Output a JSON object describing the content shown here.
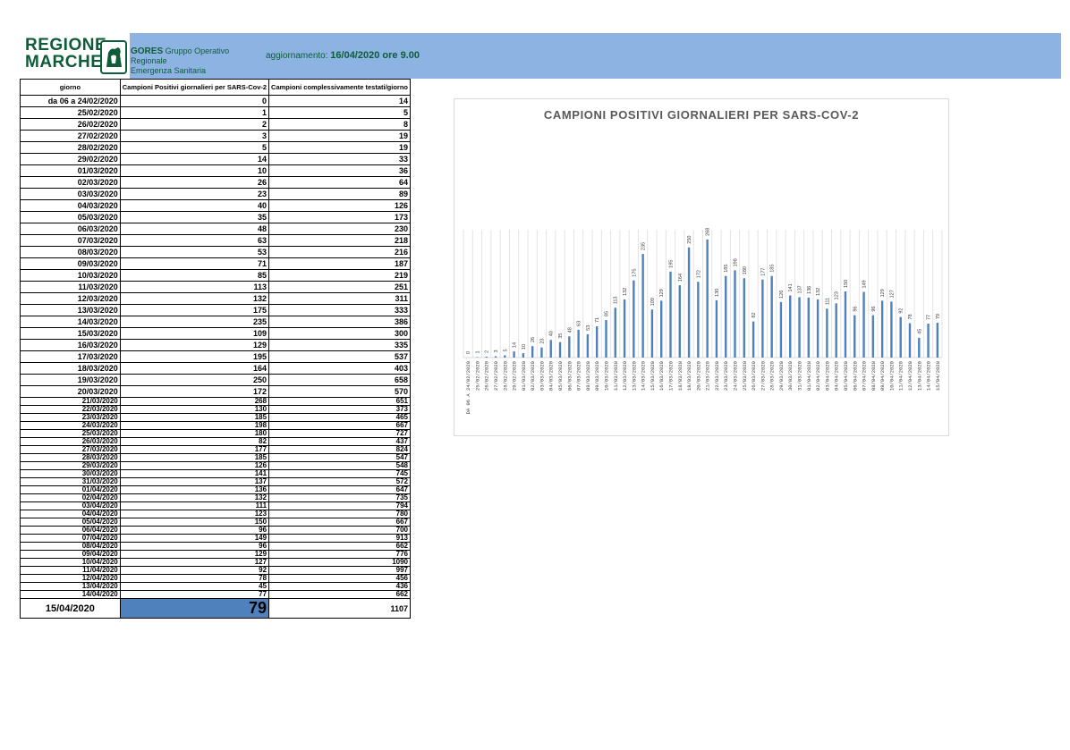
{
  "header": {
    "logo_line1": "REGIONE",
    "logo_line2": "MARCHE",
    "gores_name": "GORES",
    "gores_desc1": "Gruppo Operativo Regionale",
    "gores_desc2": "Emergenza Sanitaria",
    "update_prefix": "aggiornamento:",
    "update_value": "16/04/2020 ore 9.00"
  },
  "colors": {
    "header_band": "#8db3e2",
    "bar": "#4f81bd",
    "logo_green": "#0e5c38"
  },
  "table": {
    "headers": [
      "giorno",
      "Campioni Positivi giornalieri per SARS-Cov-2",
      "Campioni complessivamente testati/giorno"
    ],
    "rows": [
      [
        "da 06 a 24/02/2020",
        "0",
        "14"
      ],
      [
        "25/02/2020",
        "1",
        "5"
      ],
      [
        "26/02/2020",
        "2",
        "8"
      ],
      [
        "27/02/2020",
        "3",
        "19"
      ],
      [
        "28/02/2020",
        "5",
        "19"
      ],
      [
        "29/02/2020",
        "14",
        "33"
      ],
      [
        "01/03/2020",
        "10",
        "36"
      ],
      [
        "02/03/2020",
        "26",
        "64"
      ],
      [
        "03/03/2020",
        "23",
        "89"
      ],
      [
        "04/03/2020",
        "40",
        "126"
      ],
      [
        "05/03/2020",
        "35",
        "173"
      ],
      [
        "06/03/2020",
        "48",
        "230"
      ],
      [
        "07/03/2020",
        "63",
        "218"
      ],
      [
        "08/03/2020",
        "53",
        "216"
      ],
      [
        "09/03/2020",
        "71",
        "187"
      ],
      [
        "10/03/2020",
        "85",
        "219"
      ],
      [
        "11/03/2020",
        "113",
        "251"
      ],
      [
        "12/03/2020",
        "132",
        "311"
      ],
      [
        "13/03/2020",
        "175",
        "333"
      ],
      [
        "14/03/2020",
        "235",
        "386"
      ],
      [
        "15/03/2020",
        "109",
        "300"
      ],
      [
        "16/03/2020",
        "129",
        "335"
      ],
      [
        "17/03/2020",
        "195",
        "537"
      ],
      [
        "18/03/2020",
        "164",
        "403"
      ],
      [
        "19/03/2020",
        "250",
        "658"
      ],
      [
        "20/03/2020",
        "172",
        "570"
      ],
      [
        "21/03/2020",
        "268",
        "651"
      ],
      [
        "22/03/2020",
        "130",
        "373"
      ],
      [
        "23/03/2020",
        "185",
        "465"
      ],
      [
        "24/03/2020",
        "198",
        "667"
      ],
      [
        "25/03/2020",
        "180",
        "727"
      ],
      [
        "26/03/2020",
        "82",
        "437"
      ],
      [
        "27/03/2020",
        "177",
        "824"
      ],
      [
        "28/03/2020",
        "185",
        "547"
      ],
      [
        "29/03/2020",
        "126",
        "548"
      ],
      [
        "30/03/2020",
        "141",
        "745"
      ],
      [
        "31/03/2020",
        "137",
        "572"
      ],
      [
        "01/04/2020",
        "136",
        "647"
      ],
      [
        "02/04/2020",
        "132",
        "735"
      ],
      [
        "03/04/2020",
        "111",
        "794"
      ],
      [
        "04/04/2020",
        "123",
        "780"
      ],
      [
        "05/04/2020",
        "150",
        "667"
      ],
      [
        "06/04/2020",
        "96",
        "700"
      ],
      [
        "07/04/2020",
        "149",
        "913"
      ],
      [
        "08/04/2020",
        "96",
        "662"
      ],
      [
        "09/04/2020",
        "129",
        "776"
      ],
      [
        "10/04/2020",
        "127",
        "1090"
      ],
      [
        "11/04/2020",
        "92",
        "997"
      ],
      [
        "12/04/2020",
        "78",
        "456"
      ],
      [
        "13/04/2020",
        "45",
        "436"
      ],
      [
        "14/04/2020",
        "77",
        "662"
      ],
      [
        "15/04/2020",
        "79",
        "1107"
      ]
    ]
  },
  "chart_data": {
    "type": "bar",
    "title": "CAMPIONI POSITIVI GIORNALIERI PER SARS-COV-2",
    "xlabel": "",
    "ylabel": "",
    "categories": [
      "DA 06 A 24/02/2020",
      "25/02/2020",
      "26/02/2020",
      "27/02/2020",
      "28/02/2020",
      "29/02/2020",
      "01/03/2020",
      "02/03/2020",
      "03/03/2020",
      "04/03/2020",
      "05/03/2020",
      "06/03/2020",
      "07/03/2020",
      "08/03/2020",
      "09/03/2020",
      "10/03/2020",
      "11/03/2020",
      "12/03/2020",
      "13/03/2020",
      "14/03/2020",
      "15/03/2020",
      "16/03/2020",
      "17/03/2020",
      "18/03/2020",
      "19/03/2020",
      "20/03/2020",
      "21/03/2020",
      "22/03/2020",
      "23/03/2020",
      "24/03/2020",
      "25/03/2020",
      "26/03/2020",
      "27/03/2020",
      "28/03/2020",
      "29/03/2020",
      "30/03/2020",
      "31/03/2020",
      "01/04/2020",
      "02/04/2020",
      "03/04/2020",
      "04/04/2020",
      "05/04/2020",
      "06/04/2020",
      "07/04/2020",
      "08/04/2020",
      "09/04/2020",
      "10/04/2020",
      "11/04/2020",
      "12/04/2020",
      "13/04/2020",
      "14/04/2020",
      "15/04/2020"
    ],
    "values": [
      0,
      1,
      2,
      3,
      5,
      14,
      10,
      26,
      23,
      40,
      35,
      48,
      63,
      53,
      71,
      85,
      113,
      132,
      175,
      235,
      109,
      129,
      195,
      164,
      250,
      172,
      268,
      130,
      185,
      198,
      180,
      82,
      177,
      185,
      126,
      141,
      137,
      136,
      132,
      111,
      123,
      150,
      96,
      149,
      96,
      129,
      127,
      92,
      78,
      45,
      77,
      79
    ],
    "ylim": [
      0,
      290
    ],
    "grid": "vertical",
    "legend": "none"
  }
}
